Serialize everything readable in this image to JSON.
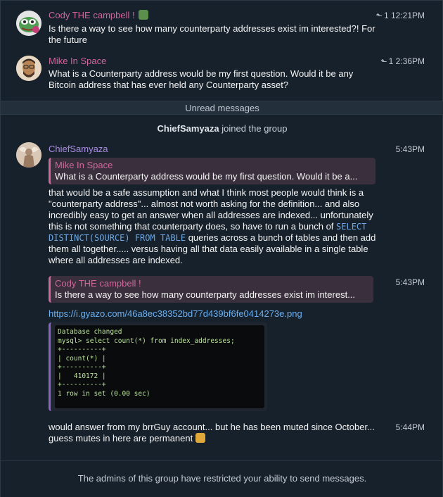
{
  "messages": [
    {
      "author": "Cody THE campbell !",
      "time": "1 12:21PM",
      "text": "Is there a way to see how many counterparty addresses exist im interested?! For the future"
    },
    {
      "author": "Mike In Space",
      "time": "1 2:36PM",
      "text": "What is a Counterparty address would be my first question. Would it be any Bitcoin address that has ever held any Counterparty asset?"
    }
  ],
  "unread_label": "Unread messages",
  "service": {
    "actor": "ChiefSamyaza",
    "action": " joined the group"
  },
  "chief_reply_1": {
    "author": "ChiefSamyaza",
    "time": "5:43PM",
    "quote_author": "Mike In Space",
    "quote_text": "What is a Counterparty address would be my first question. Would it be a...",
    "text_before_code": "that would be a safe assumption and what I think most people would think is a \"counterparty address\"... almost not worth asking for the definition... and also incredibly easy to get an answer when all addresses are indexed... unfortunately this is not something that counterparty does, so have to run a bunch of ",
    "code": "SELECT DISTINCT(SOURCE) FROM TABLE",
    "text_after_code": " queries across a bunch of tables and then add them all together..... versus having all that data easily available in a single table where all addresses are indexed."
  },
  "chief_reply_2": {
    "time": "5:43PM",
    "quote_author": "Cody THE campbell !",
    "quote_text": "Is there a way to see how many counterparty addresses exist im interest...",
    "link": "https://i.gyazo.com/46a8ec38352bd77d439bf6fe0414273e.png",
    "terminal": "Database changed\nmysql> select count(*) from index_addresses;\n+----------+\n| count(*) |\n+----------+\n|   410172 |\n+----------+\n1 row in set (0.00 sec)"
  },
  "chief_reply_3": {
    "time": "5:44PM",
    "text": "would answer from my brrGuy account... but he has been muted since October... guess mutes in here are permanent "
  },
  "restricted_notice": "The admins of this group have restricted your ability to send messages.",
  "icons": {
    "reply": "reply-arrow-icon",
    "emoji_pepe": "pepe-emoji-icon",
    "emoji_shrug": "shrug-emoji-icon"
  },
  "colors": {
    "background": "#17212b",
    "name_pink": "#d0669c",
    "name_purple": "#a98be0",
    "link": "#6ab0f3"
  }
}
